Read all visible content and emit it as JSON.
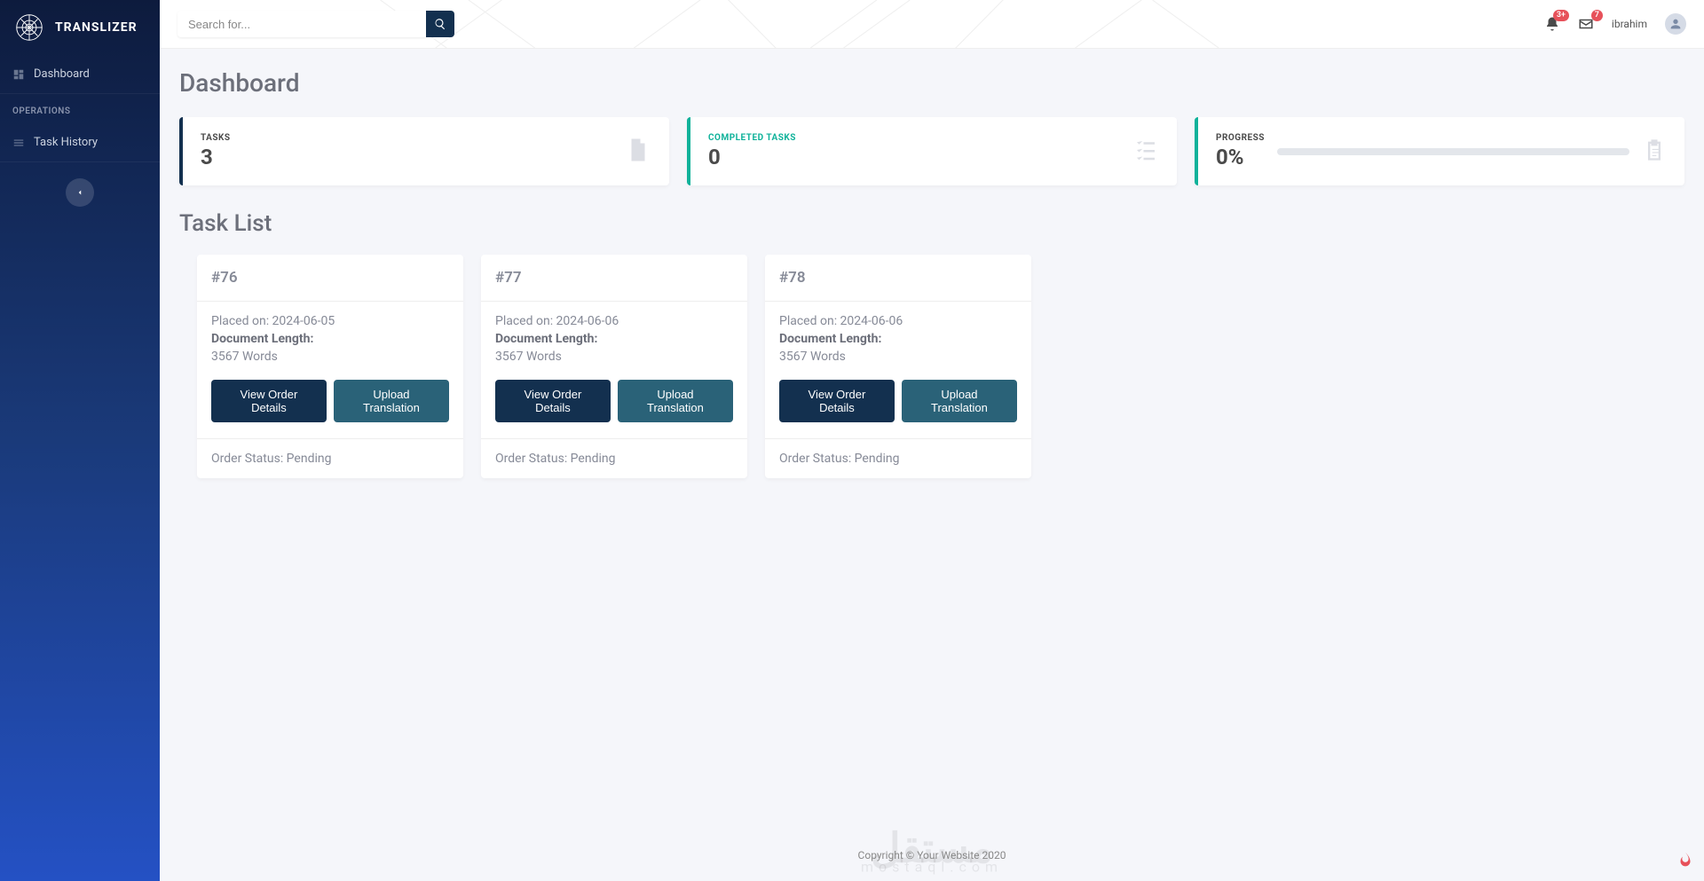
{
  "brand": {
    "name": "TRANSLIZER"
  },
  "search": {
    "placeholder": "Search for..."
  },
  "notifications": {
    "bell_badge": "3+",
    "mail_badge": "7"
  },
  "user": {
    "name": "ibrahim"
  },
  "sidebar": {
    "dashboard": "Dashboard",
    "operations_label": "OPERATIONS",
    "task_history": "Task History"
  },
  "page": {
    "title": "Dashboard",
    "task_list_title": "Task List"
  },
  "stats": {
    "tasks": {
      "label": "TASKS",
      "value": "3"
    },
    "completed": {
      "label": "COMPLETED TASKS",
      "value": "0"
    },
    "progress": {
      "label": "PROGRESS",
      "value": "0%"
    }
  },
  "labels": {
    "placed_on": "Placed on: ",
    "doc_length": "Document Length:",
    "view_details": "View Order Details",
    "upload_translation": "Upload Translation",
    "order_status": "Order Status: "
  },
  "tasks": [
    {
      "id": "#76",
      "placed_on": "2024-06-05",
      "doc_length": "3567 Words",
      "status": "Pending"
    },
    {
      "id": "#77",
      "placed_on": "2024-06-06",
      "doc_length": "3567 Words",
      "status": "Pending"
    },
    {
      "id": "#78",
      "placed_on": "2024-06-06",
      "doc_length": "3567 Words",
      "status": "Pending"
    }
  ],
  "footer": {
    "text": "Copyright © Your Website 2020",
    "watermark": "مستقل",
    "watermark_sub": "mostaql.com"
  }
}
